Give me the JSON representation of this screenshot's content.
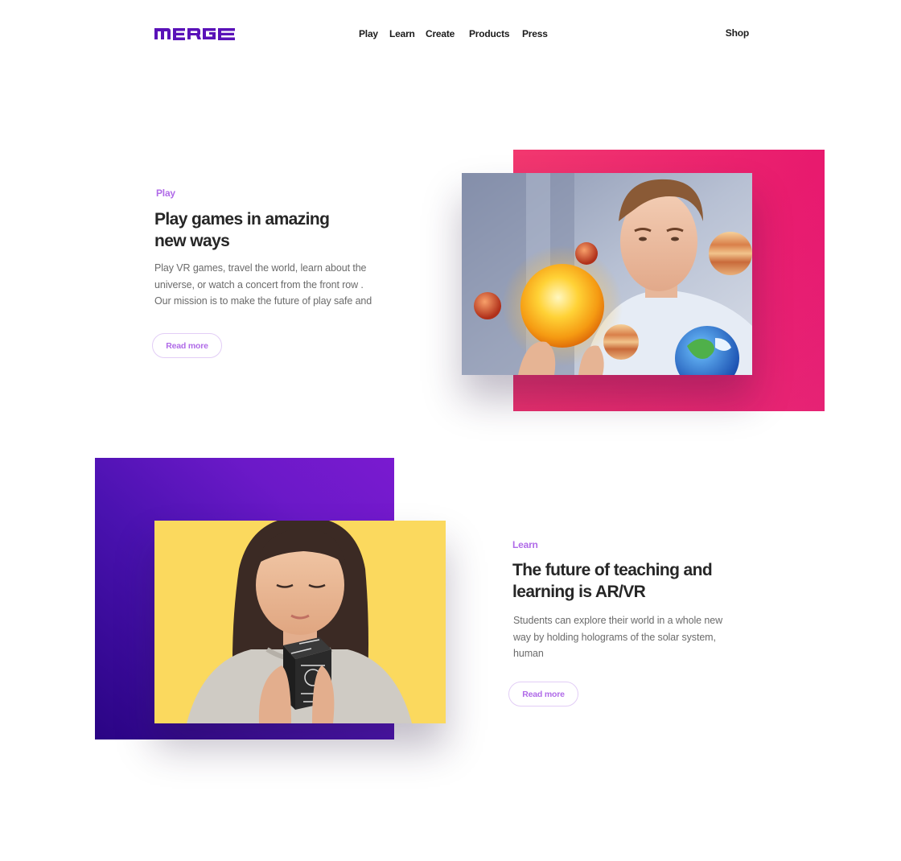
{
  "brand": {
    "logo_text": "MERGE",
    "color": "#5a12b8"
  },
  "nav": {
    "items": [
      "Play",
      "Learn",
      "Create",
      "Products",
      "Press"
    ],
    "shop": "Shop"
  },
  "sections": [
    {
      "eyebrow": "Play",
      "title_line1": "Play games in amazing",
      "title_line2": "new ways",
      "body_line1": "Play VR games, travel the world, learn about the",
      "body_line2": "universe, or watch a concert from the front row .",
      "body_line3": "Our mission is to make the future of play safe and",
      "button": "Read more",
      "accent": "#e8196e",
      "image_icon": "boy-with-planets-hologram"
    },
    {
      "eyebrow": "Learn",
      "title_line1": "The future of teaching and",
      "title_line2": "learning is AR/VR",
      "body_line1": "Students can explore their world in a whole new",
      "body_line2": "way by holding holograms of the solar system,",
      "body_line3": "human",
      "button": "Read more",
      "accent": "#4a12b0",
      "image_icon": "girl-holding-merge-cube"
    }
  ],
  "colors": {
    "eyebrow": "#b06be8",
    "heading": "#262626",
    "body": "#6b6b6b"
  }
}
